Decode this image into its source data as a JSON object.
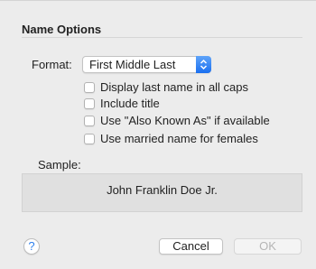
{
  "section": {
    "title": "Name Options"
  },
  "format": {
    "label": "Format:",
    "selected": "First Middle Last"
  },
  "options": [
    {
      "label": "Display last name in all caps",
      "checked": false
    },
    {
      "label": "Include title",
      "checked": false
    },
    {
      "label": "Use \"Also Known As\" if available",
      "checked": false
    },
    {
      "label": "Use married name for females",
      "checked": false
    }
  ],
  "sample": {
    "label": "Sample:",
    "text": "John Franklin Doe Jr."
  },
  "buttons": {
    "help": "?",
    "cancel": "Cancel",
    "ok": "OK"
  },
  "colors": {
    "accent": "#1a6ff0",
    "help": "#2f80ed"
  }
}
